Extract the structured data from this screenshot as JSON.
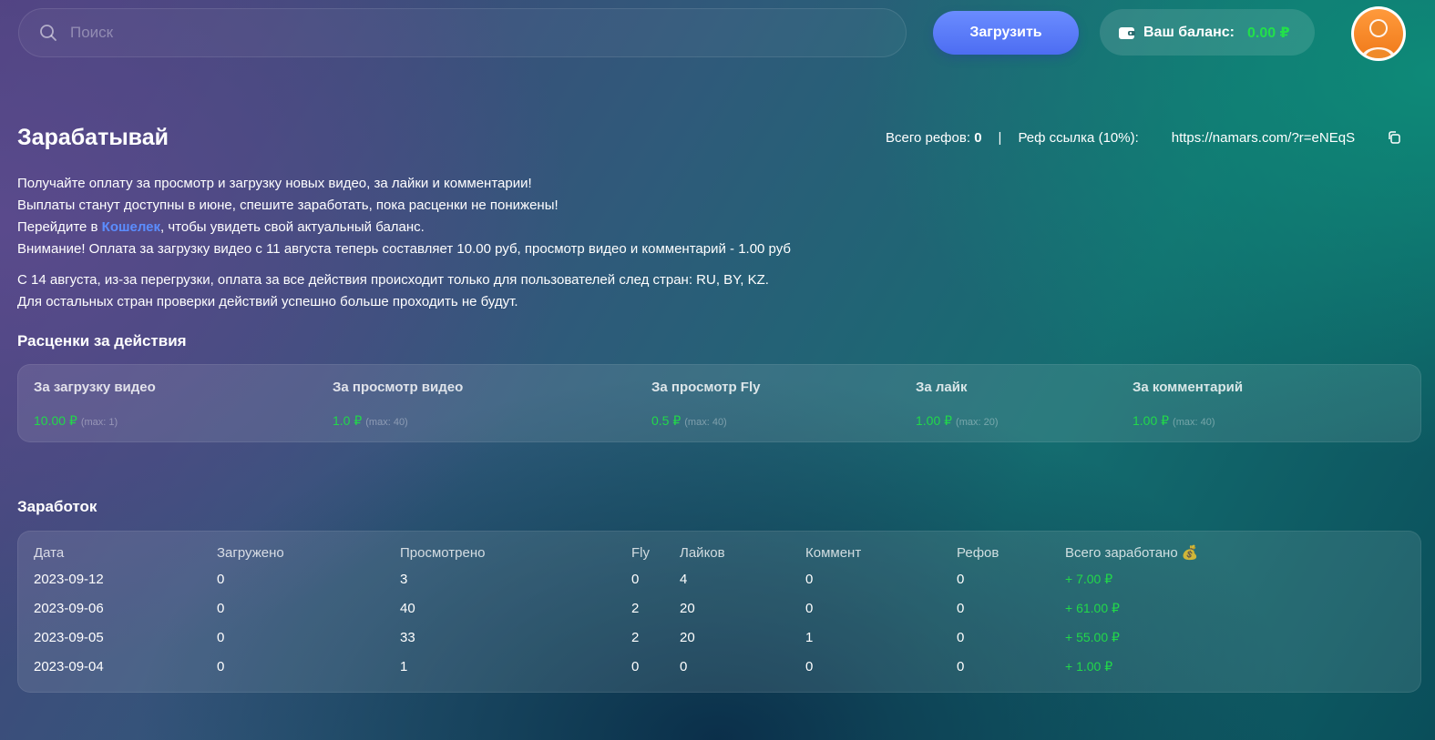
{
  "header": {
    "search_placeholder": "Поиск",
    "upload_label": "Загрузить",
    "balance_label": "Ваш баланс:",
    "balance_value": "0.00 ₽"
  },
  "earn": {
    "title": "Зарабатывай",
    "refs_label": "Всего рефов:",
    "refs_count": "0",
    "separator": "|",
    "ref_link_label": "Реф ссылка (10%):",
    "ref_link": "https://namars.com/?r=eNEqS",
    "desc_line1": "Получайте оплату за просмотр и загрузку новых видео, за лайки и комментарии!",
    "desc_line2": "Выплаты станут доступны в июне, спешите заработать, пока расценки не понижены!",
    "desc_line3_pre": "Перейдите в ",
    "desc_line3_link": "Кошелек",
    "desc_line3_post": ", чтобы увидеть свой актуальный баланс.",
    "desc_line4": "Внимание! Оплата за загрузку видео с 11 августа теперь составляет 10.00 руб, просмотр видео и комментарий - 1.00 руб",
    "desc_line5": "С 14 августа, из-за перегрузки, оплата за все действия происходит только для пользователей след стран: RU, BY, KZ.",
    "desc_line6": "Для остальных стран проверки действий успешно больше проходить не будут."
  },
  "rates": {
    "title": "Расценки за действия",
    "items": [
      {
        "label": "За загрузку видео",
        "amount": "10.00 ₽",
        "max": "(max: 1)"
      },
      {
        "label": "За просмотр видео",
        "amount": "1.0 ₽",
        "max": "(max: 40)"
      },
      {
        "label": "За просмотр Fly",
        "amount": "0.5 ₽",
        "max": "(max: 40)"
      },
      {
        "label": "За лайк",
        "amount": "1.00 ₽",
        "max": "(max: 20)"
      },
      {
        "label": "За комментарий",
        "amount": "1.00 ₽",
        "max": "(max: 40)"
      }
    ]
  },
  "earnings": {
    "title": "Заработок",
    "columns": [
      "Дата",
      "Загружено",
      "Просмотрено",
      "Fly",
      "Лайков",
      "Коммент",
      "Рефов",
      "Всего заработано 💰"
    ],
    "rows": [
      [
        "2023-09-12",
        "0",
        "3",
        "0",
        "4",
        "0",
        "0",
        "+ 7.00 ₽"
      ],
      [
        "2023-09-06",
        "0",
        "40",
        "2",
        "20",
        "0",
        "0",
        "+ 61.00 ₽"
      ],
      [
        "2023-09-05",
        "0",
        "33",
        "2",
        "20",
        "1",
        "0",
        "+ 55.00 ₽"
      ],
      [
        "2023-09-04",
        "0",
        "1",
        "0",
        "0",
        "0",
        "0",
        "+ 1.00 ₽"
      ]
    ]
  },
  "colors": {
    "accent_green": "#22d84a",
    "link_blue": "#5b8dff",
    "button_blue": "#5a7cfa"
  }
}
